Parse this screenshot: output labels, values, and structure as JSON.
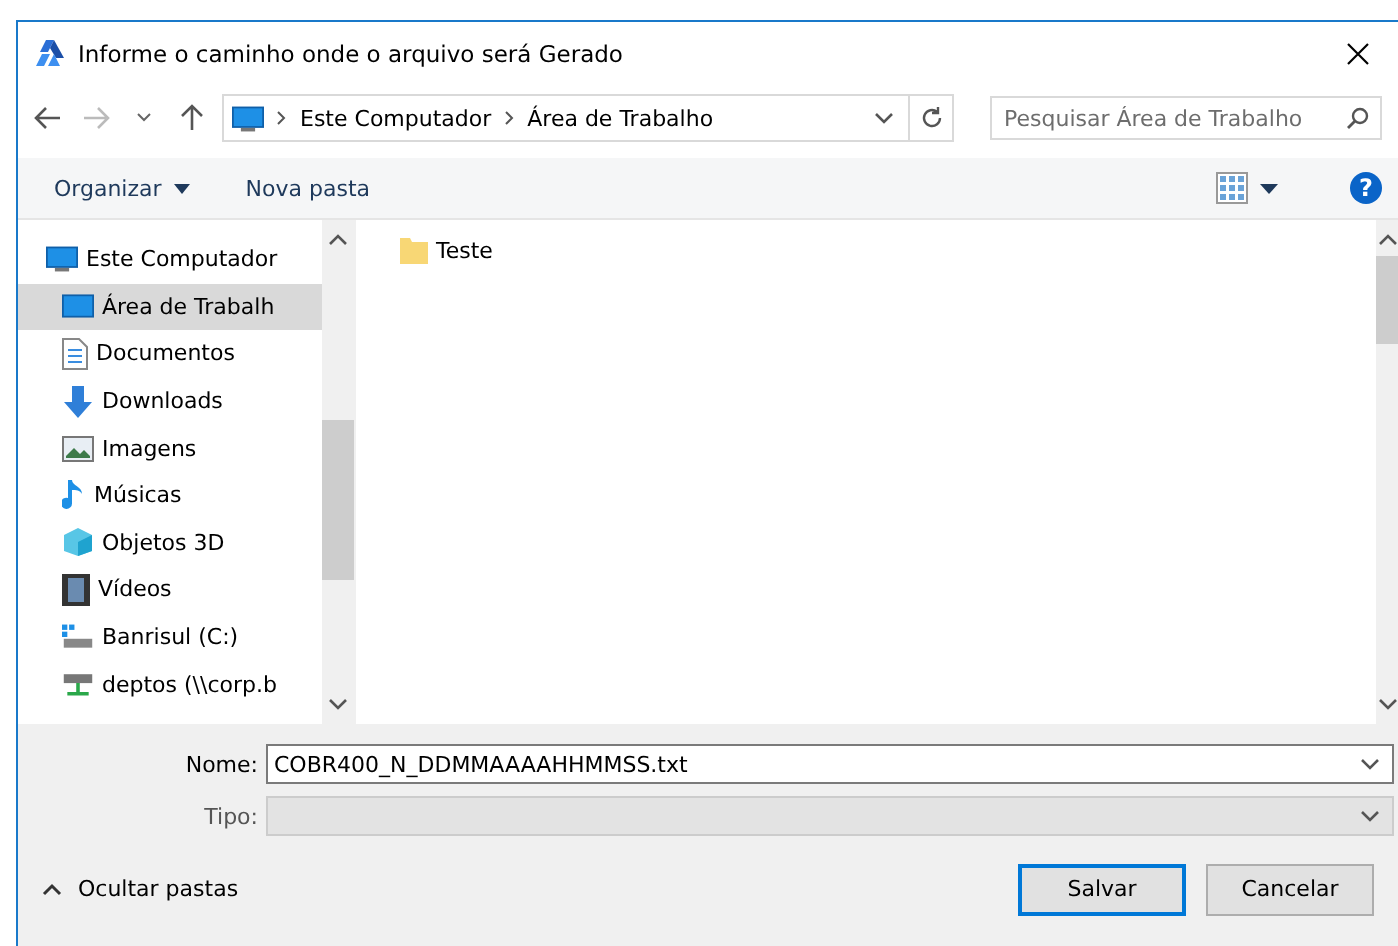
{
  "window": {
    "title": "Informe o caminho onde o arquivo será Gerado"
  },
  "address_bar": {
    "path": [
      "Este Computador",
      "Área de Trabalho"
    ]
  },
  "search": {
    "placeholder": "Pesquisar Área de Trabalho"
  },
  "toolbar": {
    "items": [
      "Organizar",
      "Nova pasta"
    ],
    "help": "?"
  },
  "sidebar": {
    "items": [
      {
        "label": "Este Computador",
        "selected": false,
        "children": [
          {
            "label": "Área de Trabalh",
            "selected": true
          },
          {
            "label": "Documentos",
            "selected": false
          },
          {
            "label": "Downloads",
            "selected": false
          },
          {
            "label": "Imagens",
            "selected": false
          },
          {
            "label": "Músicas",
            "selected": false
          },
          {
            "label": "Objetos 3D",
            "selected": false
          },
          {
            "label": "Vídeos",
            "selected": false
          },
          {
            "label": "Banrisul (C:)",
            "selected": false
          },
          {
            "label": "deptos (\\\\corp.b",
            "selected": false
          }
        ]
      }
    ]
  },
  "files": [
    {
      "name": "Teste",
      "kind": "folder"
    }
  ],
  "form": {
    "name_label": "Nome:",
    "name_value": "COBR400_N_DDMMAAAAHHMMSS.txt",
    "type_label": "Tipo:",
    "type_disabled": true
  },
  "footer": {
    "toggle": "Ocultar pastas",
    "buttons": [
      {
        "label": "Salvar",
        "default": true
      },
      {
        "label": "Cancelar",
        "default": false
      }
    ]
  }
}
